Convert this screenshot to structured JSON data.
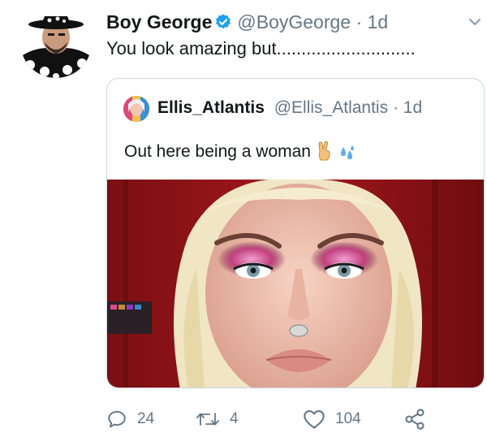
{
  "tweet": {
    "author_name": "Boy George",
    "author_handle": "@BoyGeorge",
    "separator": "·",
    "time": "1d",
    "text": "You look amazing but............................"
  },
  "quoted_tweet": {
    "author_name": "Ellis_Atlantis",
    "author_handle": "@Ellis_Atlantis",
    "separator": "·",
    "time": "1d",
    "text": "Out here being a woman"
  },
  "actions": {
    "replies": "24",
    "retweets": "4",
    "likes": "104"
  },
  "colors": {
    "verified": "#1da1f2",
    "muted_text": "#657786",
    "border": "#ccd6dd"
  },
  "icons": [
    "verified-badge-icon",
    "chevron-down-icon",
    "victory-hand-icon",
    "sweat-droplets-icon",
    "reply-icon",
    "retweet-icon",
    "like-icon",
    "share-icon"
  ]
}
